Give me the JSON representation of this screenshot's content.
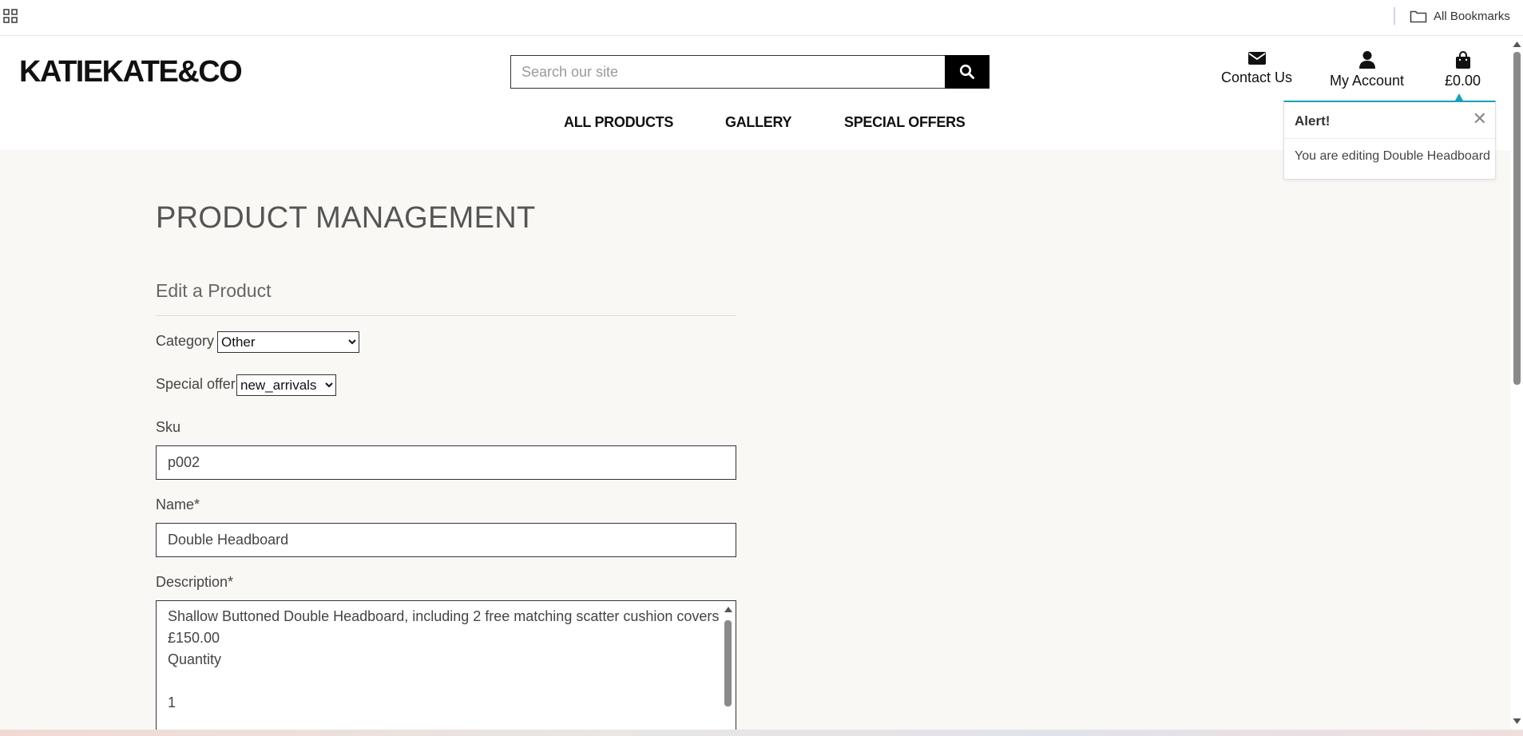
{
  "browser": {
    "bookmarks_label": "All Bookmarks"
  },
  "header": {
    "logo": "KATIEKATE&CO",
    "search_placeholder": "Search our site",
    "contact_label": "Contact Us",
    "account_label": "My Account",
    "bag_total": "£0.00"
  },
  "nav": {
    "items": [
      {
        "label": "ALL PRODUCTS"
      },
      {
        "label": "GALLERY"
      },
      {
        "label": "SPECIAL OFFERS"
      }
    ]
  },
  "alert": {
    "title": "Alert!",
    "message": "You are editing Double Headboard"
  },
  "main": {
    "page_title": "PRODUCT MANAGEMENT",
    "section_title": "Edit a Product",
    "category": {
      "label": "Category",
      "selected": "Other"
    },
    "special_offer": {
      "label": "Special offer",
      "selected": "new_arrivals"
    },
    "sku": {
      "label": "Sku",
      "value": "p002"
    },
    "name": {
      "label": "Name*",
      "value": "Double Headboard"
    },
    "description": {
      "label": "Description*",
      "lines": [
        "Shallow Buttoned Double Headboard, including 2 free matching scatter cushion covers",
        "£150.00",
        "Quantity",
        "",
        "1"
      ]
    }
  },
  "colors": {
    "accent": "#17a2b8",
    "page_bg": "#f9f8f5",
    "search_button": "#000000"
  },
  "icons": {
    "apps": "apps-grid-icon",
    "folder": "folder-icon",
    "search": "search-icon",
    "contact": "envelope-icon",
    "account": "user-icon",
    "bag": "shopping-bag-icon",
    "close": "close-icon"
  }
}
